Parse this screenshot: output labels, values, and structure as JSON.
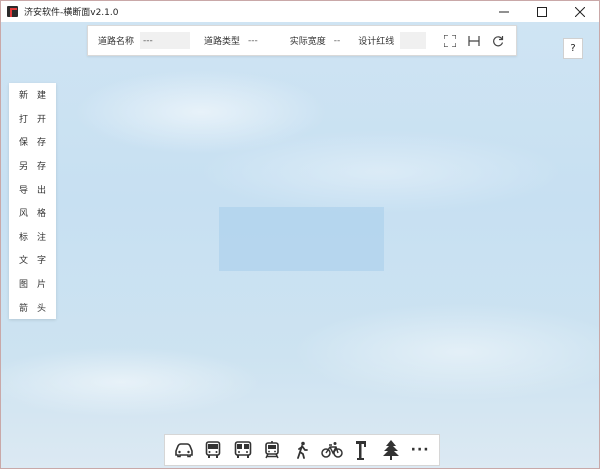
{
  "window": {
    "title": "济安软件-横断面v2.1.0"
  },
  "controls": {
    "minimize": "—",
    "maximize": "☐",
    "close": "✕"
  },
  "infobar": {
    "road_name_label": "道路名称",
    "road_name_value": "---",
    "road_type_label": "道路类型",
    "road_type_value": "---",
    "actual_width_label": "实际宽度",
    "actual_width_value": "--",
    "design_redline_label": "设计红线",
    "design_redline_value": ""
  },
  "help": {
    "label": "?"
  },
  "sidebar": {
    "items": [
      {
        "label": "新建"
      },
      {
        "label": "打开"
      },
      {
        "label": "保存"
      },
      {
        "label": "另存"
      },
      {
        "label": "导出"
      },
      {
        "label": "风格"
      },
      {
        "label": "标注"
      },
      {
        "label": "文字"
      },
      {
        "label": "图片"
      },
      {
        "label": "箭头"
      }
    ]
  },
  "bottom": {
    "more": "···"
  },
  "icons": {
    "toolbar": [
      "fullscreen-icon",
      "fit-width-icon",
      "refresh-icon"
    ],
    "bottom": [
      "car-icon",
      "bus-icon",
      "brt-icon",
      "tram-icon",
      "pedestrian-icon",
      "bicycle-icon",
      "streetlight-icon",
      "tree-icon",
      "more-icon"
    ]
  }
}
